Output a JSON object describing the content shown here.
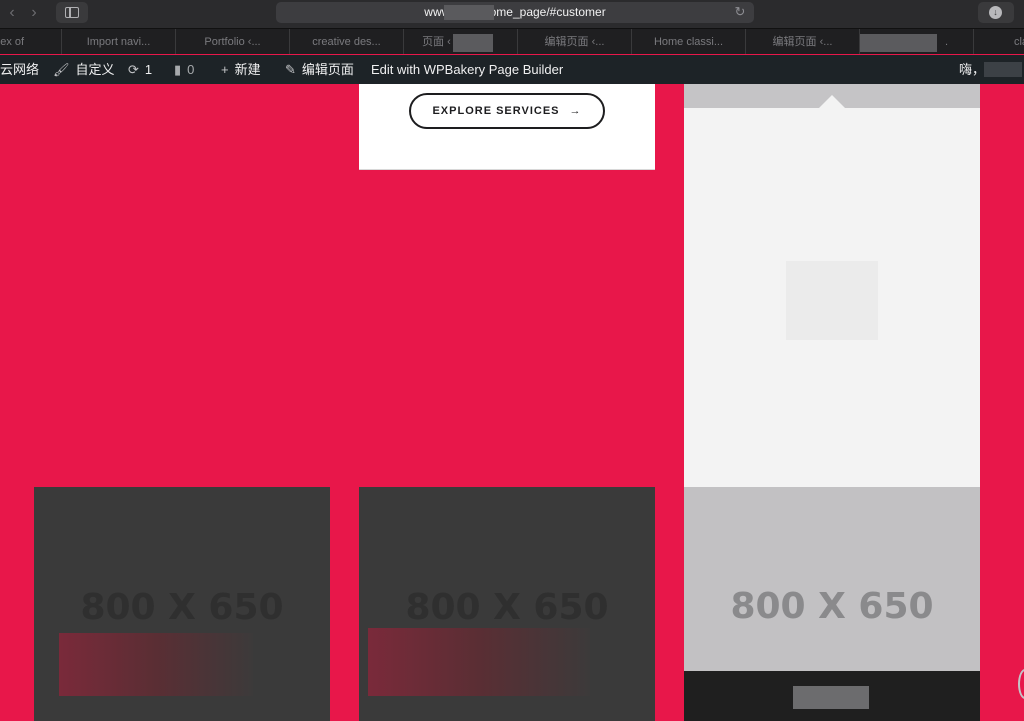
{
  "browser": {
    "back_icon": "chevron-left-icon",
    "forward_icon": "chevron-right-icon",
    "url_text": "www.           ome_page/#customer",
    "reload_icon": "reload-icon",
    "download_icon": "download-icon"
  },
  "tabs": [
    {
      "label": "Index of"
    },
    {
      "label": "Import navi..."
    },
    {
      "label": "Portfolio ‹..."
    },
    {
      "label": "creative des..."
    },
    {
      "label": "页面 ‹"
    },
    {
      "label": "编辑页面 ‹..."
    },
    {
      "label": "Home classi..."
    },
    {
      "label": "编辑页面 ‹..."
    },
    {
      "label": "."
    },
    {
      "label": "classic"
    }
  ],
  "admin_bar": {
    "network_label": "云网络",
    "customize_label": "自定义",
    "updates_count": "1",
    "comments_count": "0",
    "new_label": "新建",
    "edit_page_label": "编辑页面",
    "wpbakery_label": "Edit with WPBakery Page Builder",
    "greeting_label": "嗨，"
  },
  "content": {
    "explore_button_label": "EXPLORE SERVICES",
    "explore_arrow": "→",
    "placeholder_1": "800 X 650",
    "placeholder_2": "800 X 650",
    "placeholder_3": "800 X 650"
  },
  "colors": {
    "accent": "#e8174a",
    "admin_bar_bg": "#1d2327",
    "card_dark": "#3a3a3a"
  }
}
